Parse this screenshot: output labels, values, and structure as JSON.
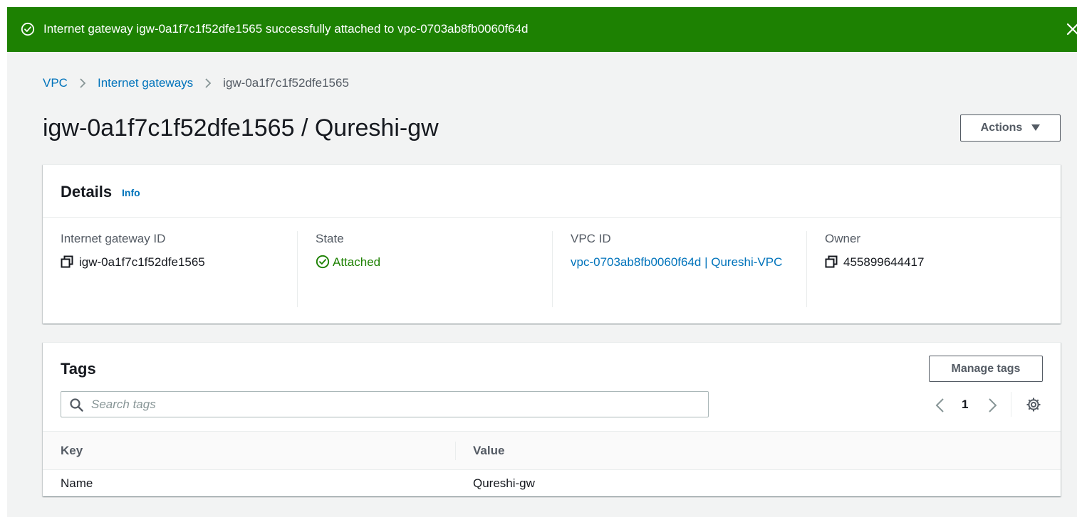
{
  "flash": {
    "message": "Internet gateway igw-0a1f7c1f52dfe1565 successfully attached to vpc-0703ab8fb0060f64d",
    "icon": "check-circle-icon",
    "close_icon": "close-icon",
    "color": "#1d8102"
  },
  "breadcrumb": {
    "items": [
      "VPC",
      "Internet gateways"
    ],
    "current": "igw-0a1f7c1f52dfe1565"
  },
  "page": {
    "title": "igw-0a1f7c1f52dfe1565 / Qureshi-gw",
    "actions_label": "Actions"
  },
  "details": {
    "title": "Details",
    "info": "Info",
    "fields": [
      {
        "label": "Internet gateway ID",
        "value": "igw-0a1f7c1f52dfe1565"
      },
      {
        "label": "State",
        "value": "Attached"
      },
      {
        "label": "VPC ID",
        "value": "vpc-0703ab8fb0060f64d | Qureshi-VPC"
      },
      {
        "label": "Owner",
        "value": "455899644417"
      }
    ]
  },
  "tags": {
    "title": "Tags",
    "manage_label": "Manage tags",
    "search_placeholder": "Search tags",
    "page": "1",
    "columns": [
      "Key",
      "Value"
    ],
    "rows": [
      {
        "key": "Name",
        "value": "Qureshi-gw"
      }
    ]
  },
  "colors": {
    "link": "#0073bb",
    "success": "#1d8102",
    "text": "#16191f",
    "muted": "#545b64"
  }
}
